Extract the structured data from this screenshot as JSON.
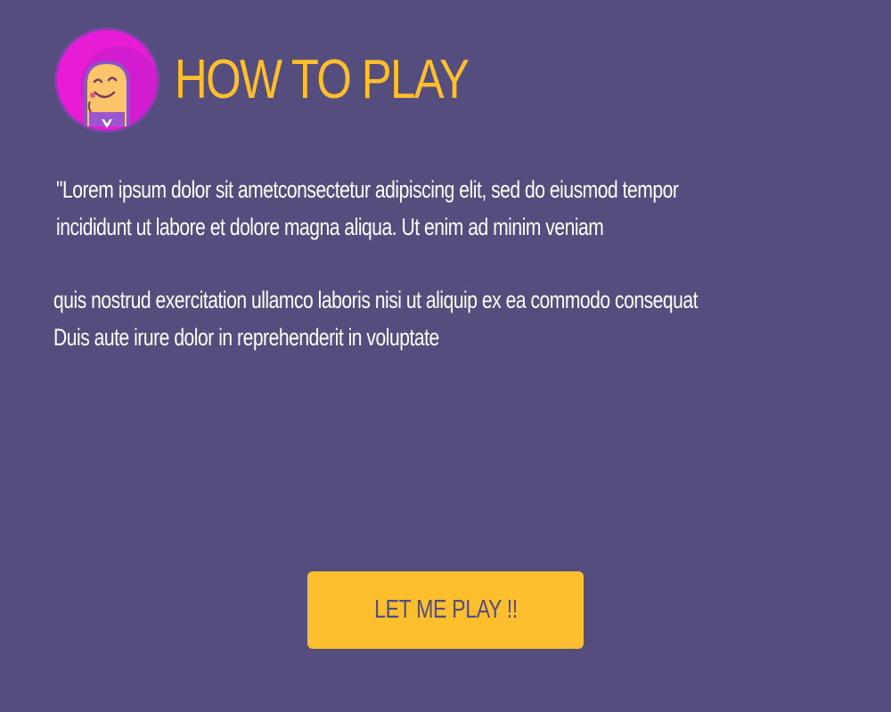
{
  "header": {
    "title": "HOW TO PLAY",
    "avatar_icon": "smiling-character-icon"
  },
  "instructions": {
    "paragraph_1": [
      "\"Lorem ipsum dolor sit ametconsectetur adipiscing elit, sed do eiusmod tempor",
      "incididunt ut labore et dolore magna aliqua. Ut enim ad minim veniam"
    ],
    "paragraph_2": [
      "quis nostrud exercitation ullamco laboris nisi ut aliquip ex ea commodo consequat",
      "Duis aute irure dolor in reprehenderit in voluptate"
    ]
  },
  "actions": {
    "play_label": "LET ME PLAY !!"
  },
  "colors": {
    "background": "#544d7d",
    "accent": "#fdbf2d",
    "text": "#ffffff",
    "avatar_ring": "#e91cd6"
  }
}
